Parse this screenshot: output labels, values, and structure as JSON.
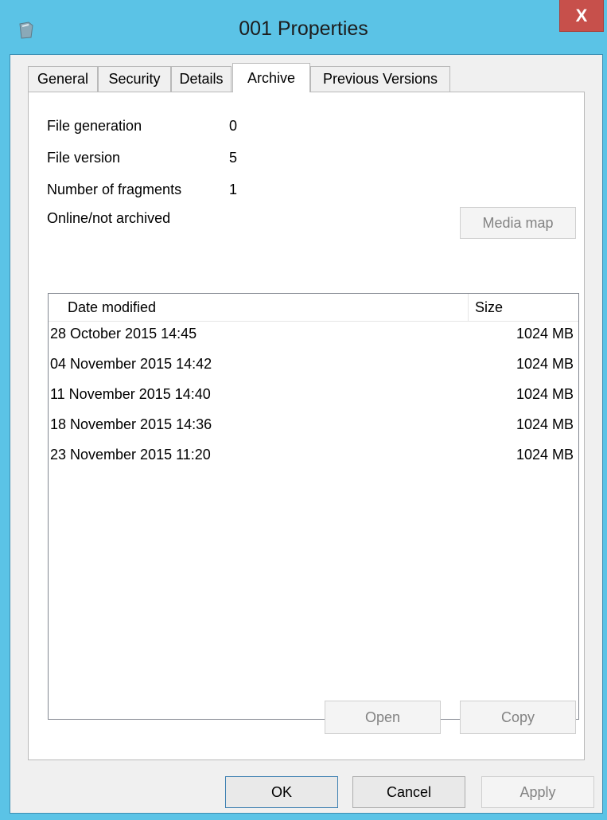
{
  "window": {
    "title": "001 Properties",
    "close_label": "X"
  },
  "tabs": [
    {
      "label": "General"
    },
    {
      "label": "Security"
    },
    {
      "label": "Details"
    },
    {
      "label": "Archive",
      "active": true
    },
    {
      "label": "Previous Versions"
    }
  ],
  "archive": {
    "properties": [
      {
        "label": "File generation",
        "value": "0"
      },
      {
        "label": "File version",
        "value": "5"
      },
      {
        "label": "Number of fragments",
        "value": "1"
      },
      {
        "label": "Online/not archived",
        "value": ""
      }
    ],
    "media_map_label": "Media map",
    "list": {
      "columns": [
        "Date modified",
        "Size"
      ],
      "rows": [
        {
          "date": "28 October 2015 14:45",
          "size": "1024 MB"
        },
        {
          "date": "04 November 2015 14:42",
          "size": "1024 MB"
        },
        {
          "date": "11 November 2015 14:40",
          "size": "1024 MB"
        },
        {
          "date": "18 November 2015 14:36",
          "size": "1024 MB"
        },
        {
          "date": "23 November 2015 11:20",
          "size": "1024 MB"
        }
      ]
    },
    "open_label": "Open",
    "copy_label": "Copy"
  },
  "footer": {
    "ok_label": "OK",
    "cancel_label": "Cancel",
    "apply_label": "Apply"
  }
}
